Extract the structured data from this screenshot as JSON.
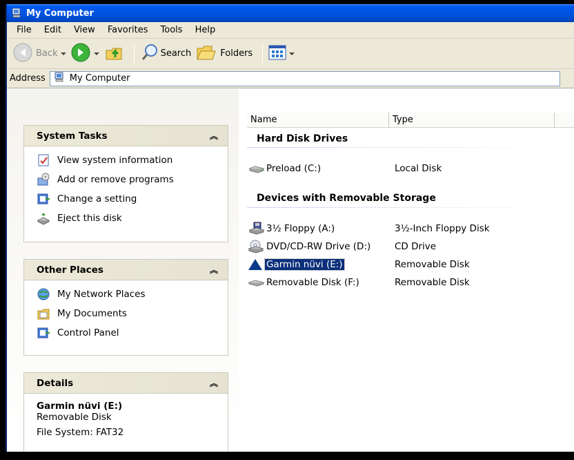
{
  "window": {
    "title": "My Computer"
  },
  "menu": [
    "File",
    "Edit",
    "View",
    "Favorites",
    "Tools",
    "Help"
  ],
  "toolbar": {
    "back_label": "Back",
    "search_label": "Search",
    "folders_label": "Folders"
  },
  "address": {
    "label": "Address",
    "value": "My Computer"
  },
  "left": {
    "system_tasks": {
      "title": "System Tasks",
      "items": [
        "View system information",
        "Add or remove programs",
        "Change a setting",
        "Eject this disk"
      ]
    },
    "other_places": {
      "title": "Other Places",
      "items": [
        "My Network Places",
        "My Documents",
        "Control Panel"
      ]
    },
    "details": {
      "title": "Details",
      "name": "Garmin nüvi (E:)",
      "type": "Removable Disk",
      "filesystem": "File System: FAT32"
    }
  },
  "list": {
    "columns": [
      "Name",
      "Type"
    ],
    "groups": [
      {
        "title": "Hard Disk Drives",
        "items": [
          {
            "name": "Preload (C:)",
            "type": "Local Disk",
            "icon": "hard-drive-icon"
          }
        ]
      },
      {
        "title": "Devices with Removable Storage",
        "items": [
          {
            "name": "3½ Floppy (A:)",
            "type": "3½-Inch Floppy Disk",
            "icon": "floppy-drive-icon"
          },
          {
            "name": "DVD/CD-RW Drive (D:)",
            "type": "CD Drive",
            "icon": "cd-drive-icon"
          },
          {
            "name": "Garmin nüvi (E:)",
            "type": "Removable Disk",
            "icon": "garmin-triangle-icon",
            "selected": true
          },
          {
            "name": "Removable Disk (F:)",
            "type": "Removable Disk",
            "icon": "removable-disk-icon"
          }
        ]
      }
    ]
  },
  "colors": {
    "title_bar": "#0054e3",
    "selection": "#0b2f7a",
    "chrome": "#ece9d8"
  }
}
